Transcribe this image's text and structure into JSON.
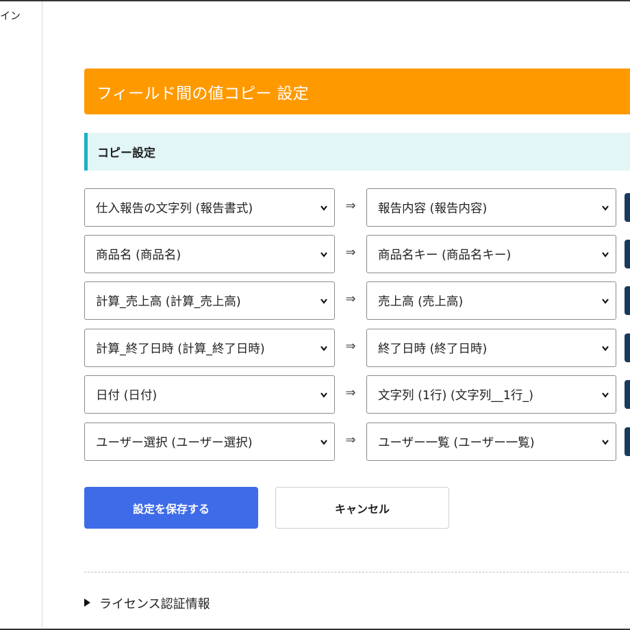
{
  "sidebar": {
    "label": "イン"
  },
  "plugin": {
    "title": "フィールド間の値コピー 設定"
  },
  "section": {
    "title": "コピー設定"
  },
  "arrow_symbol": "⇒",
  "icons": {
    "select_chevron": "chevron-down-icon",
    "expand": "triangle-right-icon"
  },
  "colors": {
    "header_bg": "#ff9900",
    "section_bg": "#e2f5f7",
    "section_accent": "#1ab0c2",
    "save_button": "#3e6be8",
    "side_button": "#1a3a5c"
  },
  "mappings": [
    {
      "source": "仕入報告の文字列 (報告書式)",
      "target": "報告内容 (報告内容)"
    },
    {
      "source": "商品名 (商品名)",
      "target": "商品名キー (商品名キー)"
    },
    {
      "source": "計算_売上高 (計算_売上高)",
      "target": "売上高 (売上高)"
    },
    {
      "source": "計算_終了日時 (計算_終了日時)",
      "target": "終了日時 (終了日時)"
    },
    {
      "source": "日付 (日付)",
      "target": "文字列 (1行) (文字列__1行_)"
    },
    {
      "source": "ユーザー選択 (ユーザー選択)",
      "target": "ユーザー一覧 (ユーザー一覧)"
    }
  ],
  "buttons": {
    "save": "設定を保存する",
    "cancel": "キャンセル"
  },
  "license": {
    "label": "ライセンス認証情報"
  }
}
